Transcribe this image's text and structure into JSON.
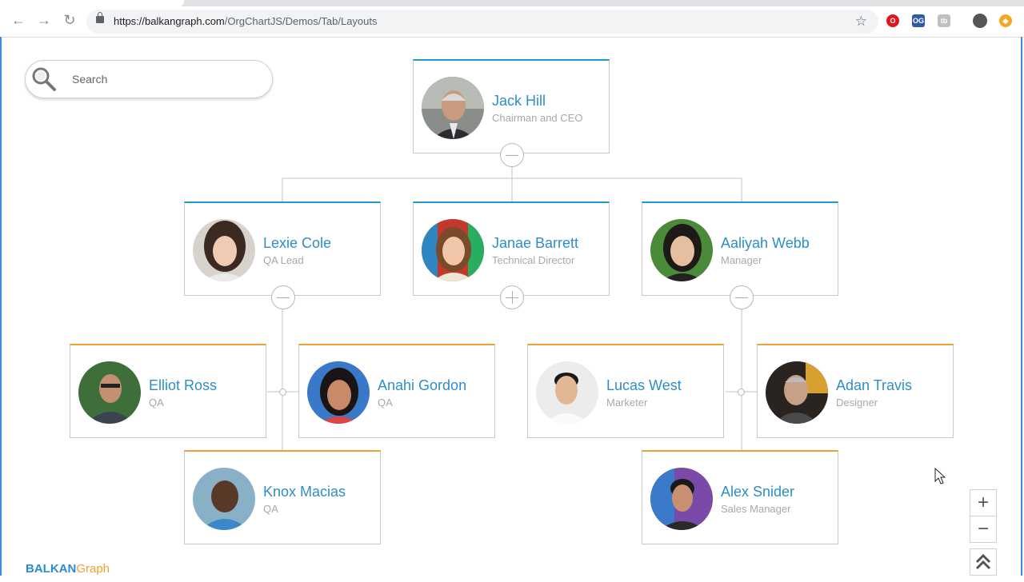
{
  "browser": {
    "url_host": "https://balkangraph.com",
    "url_path": "/OrgChartJS/Demos/Tab/Layouts",
    "back_icon": "arrow-left-icon",
    "forward_icon": "arrow-right-icon",
    "reload_icon": "reload-icon",
    "star_icon": "star-icon",
    "extensions": [
      {
        "name": "opera-extension-icon",
        "label": "O",
        "color": "#e0161c"
      },
      {
        "name": "og-extension-icon",
        "label": "OG",
        "color": "#2f5aa8"
      },
      {
        "name": "tb-extension-icon",
        "label": "tb",
        "color": "#c0c0c0"
      },
      {
        "name": "profile-avatar-icon",
        "label": "",
        "color": "#444444"
      },
      {
        "name": "orange-extension-icon",
        "label": "◆",
        "color": "#f5a623"
      }
    ]
  },
  "search": {
    "placeholder": "Search",
    "icon": "magnifier-icon"
  },
  "nodes": {
    "jack": {
      "name": "Jack Hill",
      "title": "Chairman and CEO"
    },
    "lexie": {
      "name": "Lexie Cole",
      "title": "QA Lead"
    },
    "janae": {
      "name": "Janae Barrett",
      "title": "Technical Director"
    },
    "aaliyah": {
      "name": "Aaliyah Webb",
      "title": "Manager"
    },
    "elliot": {
      "name": "Elliot Ross",
      "title": "QA"
    },
    "anahi": {
      "name": "Anahi Gordon",
      "title": "QA"
    },
    "lucas": {
      "name": "Lucas West",
      "title": "Marketer"
    },
    "adan": {
      "name": "Adan Travis",
      "title": "Designer"
    },
    "knox": {
      "name": "Knox Macias",
      "title": "QA"
    },
    "alex": {
      "name": "Alex Snider",
      "title": "Sales Manager"
    }
  },
  "colors": {
    "accent_blue": "#1d9ad6",
    "accent_orange": "#f0a030",
    "name_color": "#2f8dc7"
  },
  "zoom": {
    "in_label": "+",
    "out_label": "−",
    "fit_icon": "double-chevron-up-icon"
  },
  "logo": {
    "part1": "BALKAN",
    "part2": "Graph"
  }
}
